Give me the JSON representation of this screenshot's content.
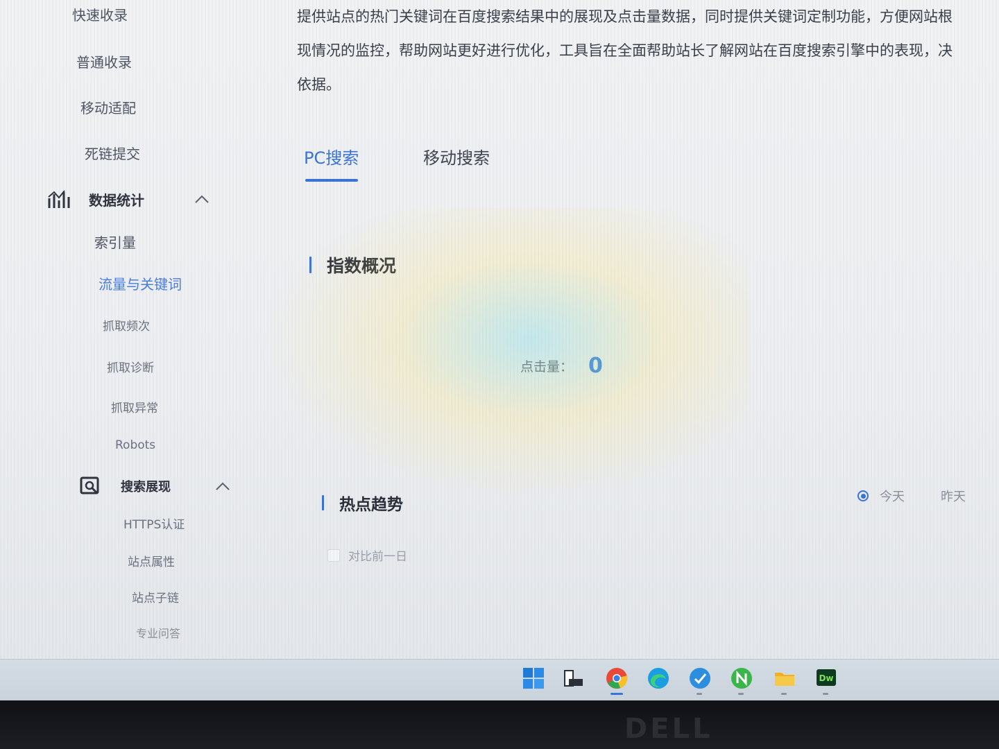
{
  "description": {
    "lines": [
      "提供站点的热门关键词在百度搜索结果中的展现及点击量数据，同时提供关键词定制功能，方便网站根",
      "现情况的监控，帮助网站更好进行优化，工具旨在全面帮助站长了解网站在百度搜索引擎中的表现，决",
      "依据。"
    ]
  },
  "sidebar": {
    "top_items": [
      "快速收录",
      "普通收录",
      "移动适配",
      "死链提交"
    ],
    "groups": [
      {
        "label": "数据统计",
        "icon": "bar-chart-icon",
        "items": [
          "索引量",
          "流量与关键词",
          "抓取频次",
          "抓取诊断",
          "抓取异常",
          "Robots"
        ]
      },
      {
        "label": "搜索展现",
        "icon": "search-display-icon",
        "items": [
          "HTTPS认证",
          "站点属性",
          "站点子链",
          "专业问答"
        ]
      }
    ],
    "active_item": "流量与关键词"
  },
  "tabs": [
    "PC搜索",
    "移动搜索"
  ],
  "overview": {
    "title": "指数概况",
    "metric_label": "点击量：",
    "metric_value": "0"
  },
  "trends": {
    "title": "热点趋势",
    "range_options": [
      "今天",
      "昨天"
    ],
    "selected_range": "今天",
    "compare_label": "对比前一日"
  },
  "brand": "DELL",
  "colors": {
    "accent": "#3a74d8",
    "metric": "#2f7fe0"
  }
}
